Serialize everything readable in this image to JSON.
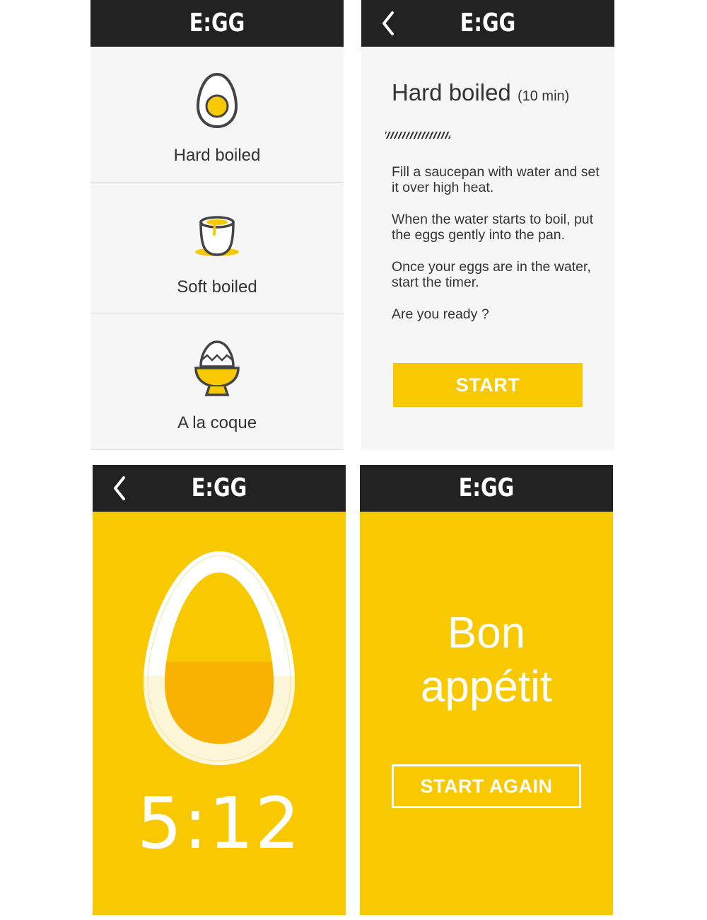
{
  "app": {
    "logo": "E:GG"
  },
  "colors": {
    "accent": "#f8c900",
    "topbar": "#222222",
    "background": "#f6f6f6",
    "text": "#333333"
  },
  "screen_menu": {
    "items": [
      {
        "label": "Hard boiled",
        "icon": "hard-boiled-egg-icon"
      },
      {
        "label": "Soft boiled",
        "icon": "soft-boiled-egg-icon"
      },
      {
        "label": "A la coque",
        "icon": "egg-cup-icon"
      }
    ]
  },
  "screen_recipe": {
    "back_icon": "chevron-left-icon",
    "title": "Hard boiled",
    "duration": "(10 min)",
    "steps": [
      "Fill a saucepan with water and set it over high heat.",
      "When the water starts to boil, put the eggs gently into the pan.",
      "Once your eggs are in the water, start the timer.",
      "Are you ready ?"
    ],
    "start_label": "START"
  },
  "screen_timer": {
    "back_icon": "chevron-left-icon",
    "time": "5:12",
    "progress": 0.48
  },
  "screen_done": {
    "line1": "Bon",
    "line2": "appétit",
    "button_label": "START AGAIN"
  }
}
